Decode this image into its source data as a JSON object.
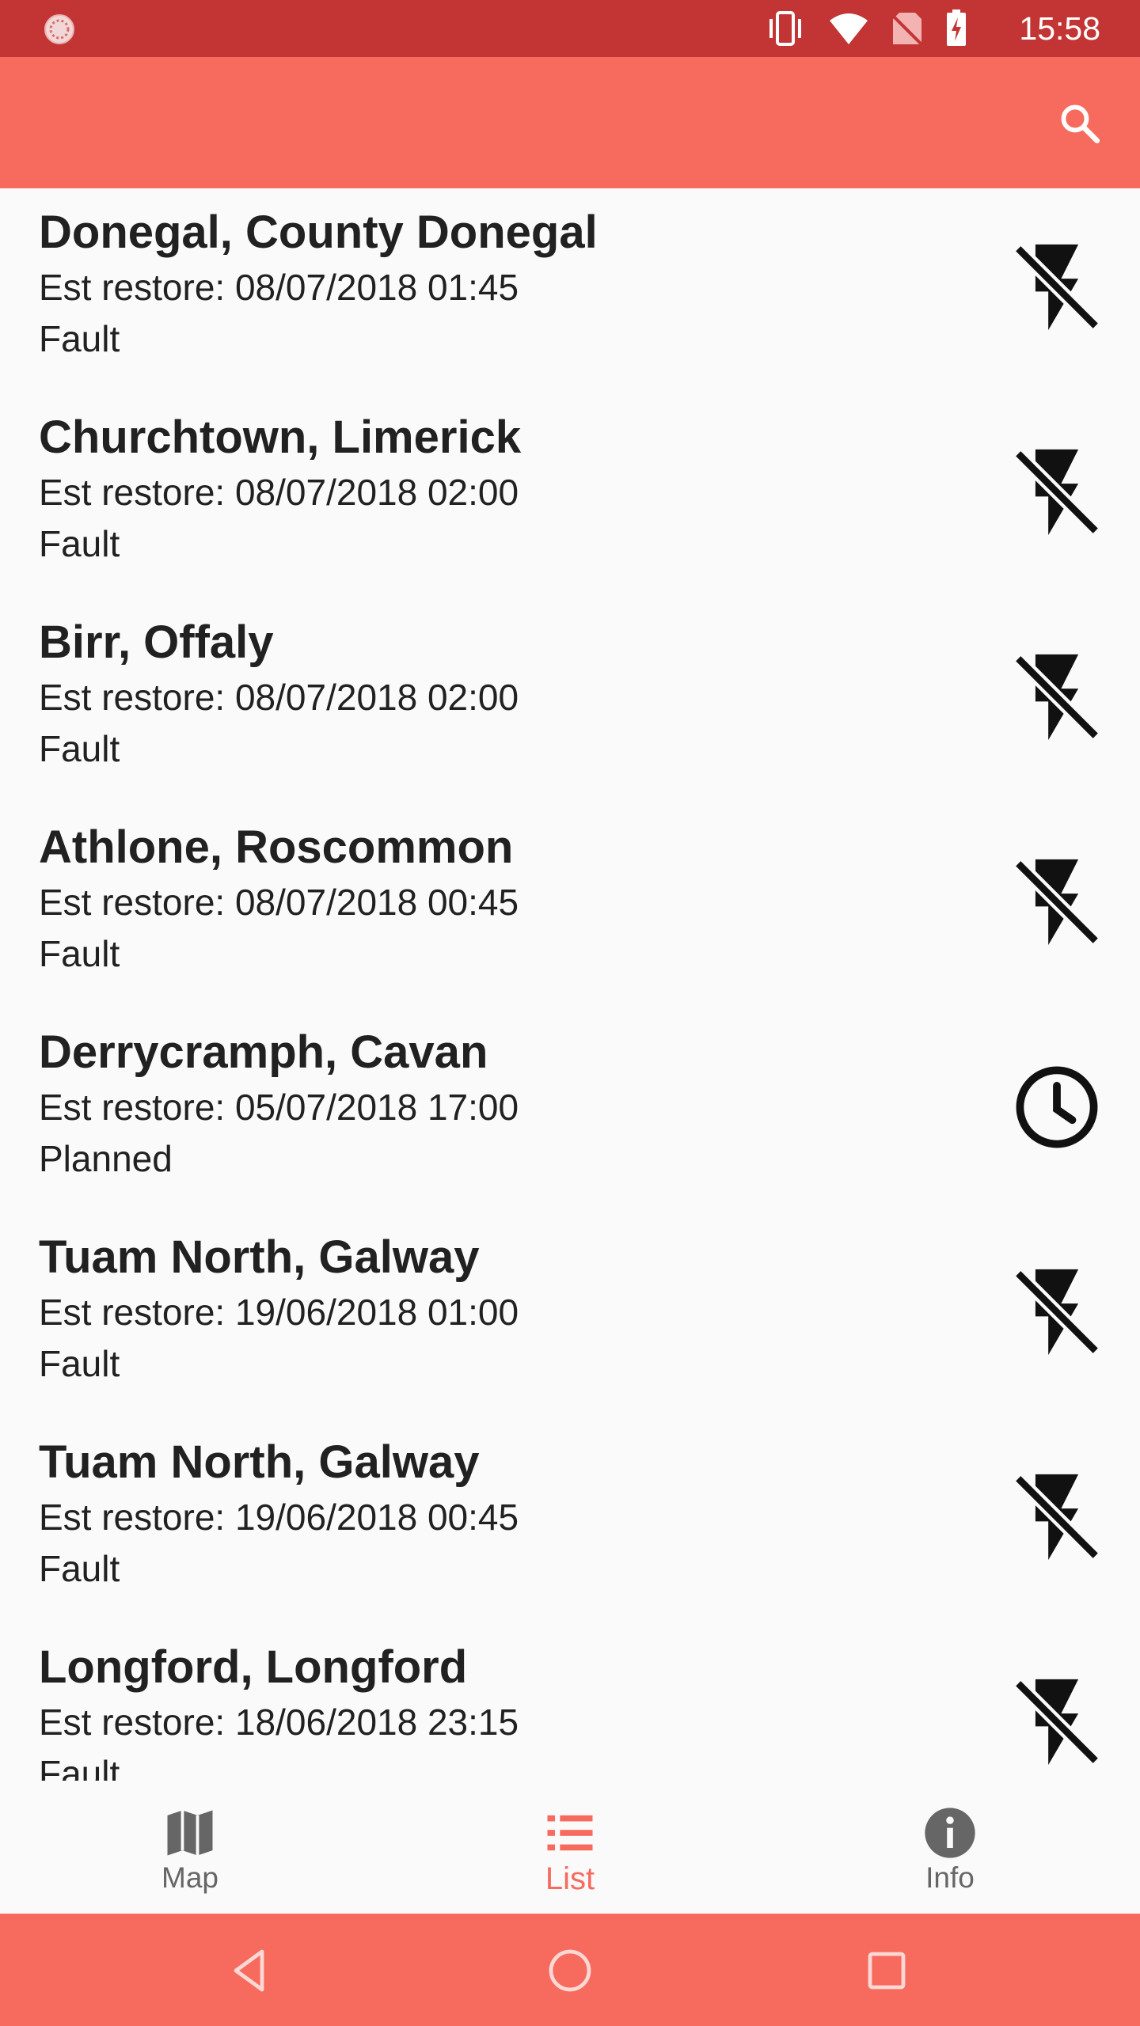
{
  "status_bar": {
    "time": "15:58",
    "color": "#c23534",
    "icons": [
      "notification-icon",
      "vibrate-icon",
      "wifi-icon",
      "no-sim-icon",
      "battery-charging-icon"
    ]
  },
  "app_bar": {
    "color": "#f76a5e",
    "search_icon": "search-icon"
  },
  "outages": [
    {
      "title": "Donegal, County Donegal",
      "restore": "Est restore: 08/07/2018 01:45",
      "type": "Fault",
      "icon": "power-off-icon"
    },
    {
      "title": "Churchtown, Limerick",
      "restore": "Est restore: 08/07/2018 02:00",
      "type": "Fault",
      "icon": "power-off-icon"
    },
    {
      "title": "Birr, Offaly",
      "restore": "Est restore: 08/07/2018 02:00",
      "type": "Fault",
      "icon": "power-off-icon"
    },
    {
      "title": "Athlone, Roscommon",
      "restore": "Est restore: 08/07/2018 00:45",
      "type": "Fault",
      "icon": "power-off-icon"
    },
    {
      "title": "Derrycramph, Cavan",
      "restore": "Est restore: 05/07/2018 17:00",
      "type": "Planned",
      "icon": "clock-icon"
    },
    {
      "title": "Tuam North, Galway",
      "restore": "Est restore: 19/06/2018 01:00",
      "type": "Fault",
      "icon": "power-off-icon"
    },
    {
      "title": "Tuam North, Galway",
      "restore": "Est restore: 19/06/2018 00:45",
      "type": "Fault",
      "icon": "power-off-icon"
    },
    {
      "title": "Longford, Longford",
      "restore": "Est restore: 18/06/2018 23:15",
      "type": "Fault",
      "icon": "power-off-icon"
    }
  ],
  "bottom_nav": {
    "items": [
      {
        "label": "Map",
        "icon": "map-icon",
        "active": false
      },
      {
        "label": "List",
        "icon": "list-icon",
        "active": true
      },
      {
        "label": "Info",
        "icon": "info-icon",
        "active": false
      }
    ],
    "active_color": "#f76a5e",
    "inactive_color": "#666666"
  },
  "system_nav": {
    "buttons": [
      "back-icon",
      "home-icon",
      "recents-icon"
    ]
  }
}
